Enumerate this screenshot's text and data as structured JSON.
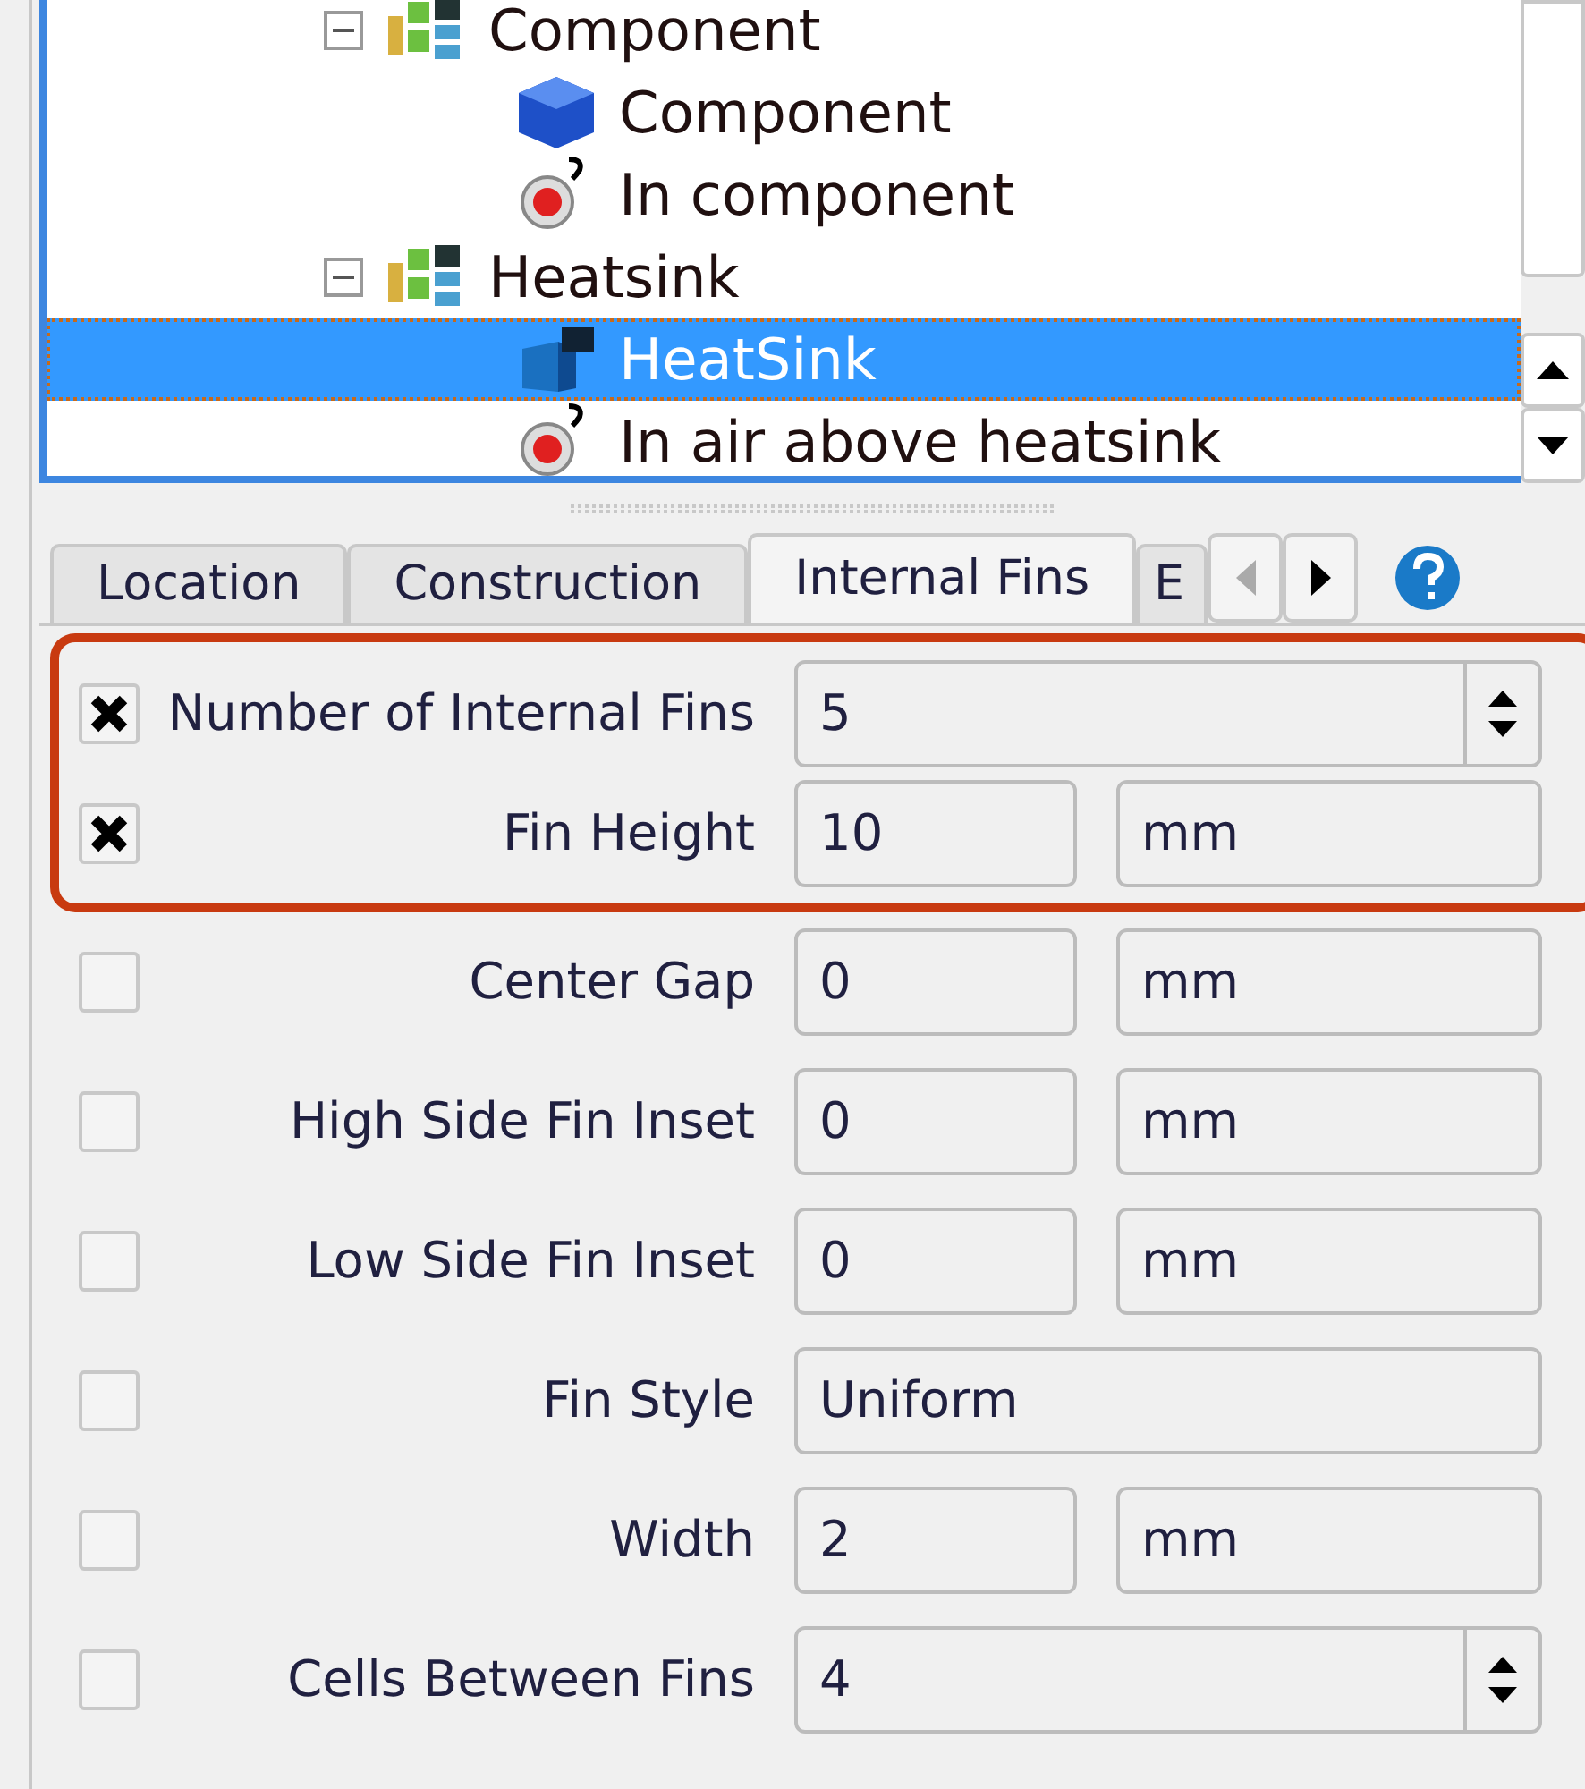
{
  "tree": [
    {
      "label": "Component",
      "kind": "group",
      "expanded": true,
      "selected": false,
      "children": [
        {
          "label": "Component",
          "kind": "block",
          "selected": false
        },
        {
          "label": "In component",
          "kind": "monitor",
          "selected": false
        }
      ]
    },
    {
      "label": "Heatsink",
      "kind": "group",
      "expanded": true,
      "selected": false,
      "children": [
        {
          "label": "HeatSink",
          "kind": "heatsink",
          "selected": true
        },
        {
          "label": "In air above heatsink",
          "kind": "monitor",
          "selected": false
        }
      ]
    }
  ],
  "tabs": [
    {
      "label": "Location",
      "selected": false
    },
    {
      "label": "Construction",
      "selected": false
    },
    {
      "label": "Internal Fins",
      "selected": true
    },
    {
      "label": "E",
      "selected": false
    }
  ],
  "rows": [
    {
      "label": "Number of Internal Fins",
      "checked": true,
      "highlighted": true,
      "kind": "spin",
      "value": "5"
    },
    {
      "label": "Fin Height",
      "checked": true,
      "highlighted": true,
      "kind": "unit",
      "value": "10",
      "unit": "mm"
    },
    {
      "label": "Center Gap",
      "checked": false,
      "highlighted": false,
      "kind": "unit",
      "value": "0",
      "unit": "mm"
    },
    {
      "label": "High Side Fin Inset",
      "checked": false,
      "highlighted": false,
      "kind": "unit",
      "value": "0",
      "unit": "mm"
    },
    {
      "label": "Low Side Fin Inset",
      "checked": false,
      "highlighted": false,
      "kind": "unit",
      "value": "0",
      "unit": "mm"
    },
    {
      "label": "Fin Style",
      "checked": false,
      "highlighted": false,
      "kind": "text",
      "value": "Uniform"
    },
    {
      "label": "Width",
      "checked": false,
      "highlighted": false,
      "kind": "unit",
      "value": "2",
      "unit": "mm"
    },
    {
      "label": "Cells Between Fins",
      "checked": false,
      "highlighted": false,
      "kind": "spin",
      "value": "4"
    }
  ]
}
